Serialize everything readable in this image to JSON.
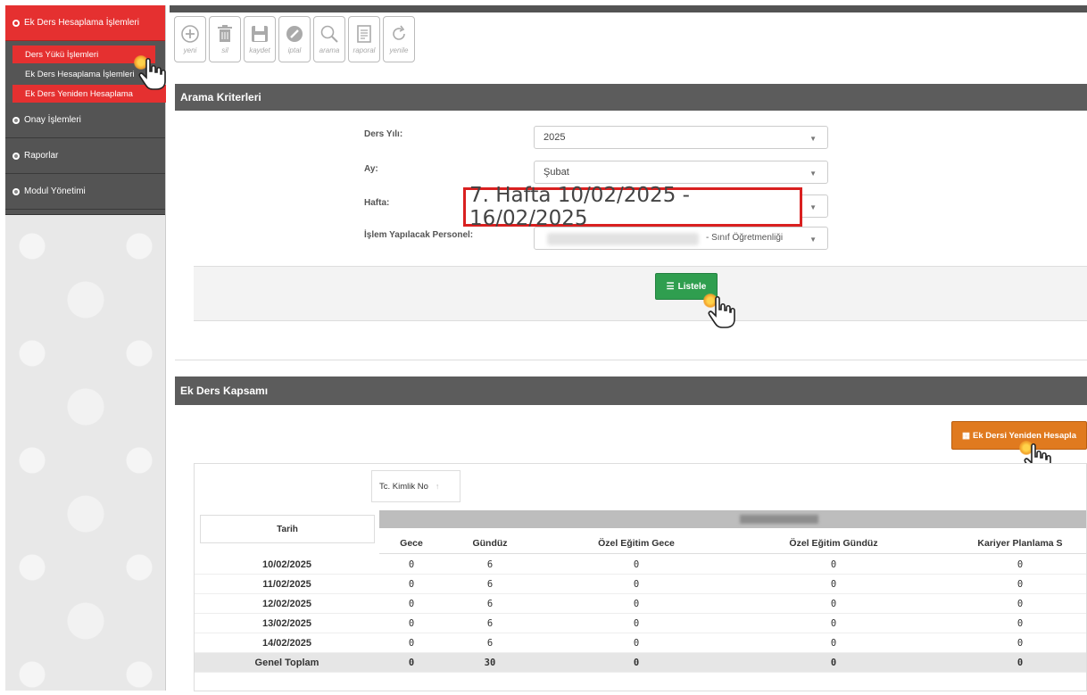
{
  "sidebar": {
    "sections": [
      {
        "label": "Ek Ders Hesaplama İşlemleri",
        "active": true
      },
      {
        "label": "Onay İşlemleri"
      },
      {
        "label": "Raporlar"
      },
      {
        "label": "Modul Yönetimi"
      }
    ],
    "sub_items": [
      {
        "label": "Ders Yükü İşlemleri"
      },
      {
        "label": "Ek Ders Hesaplama İşlemleri"
      },
      {
        "label": "Ek Ders Yeniden Hesaplama"
      }
    ]
  },
  "toolbar": {
    "buttons": [
      {
        "label": "yeni",
        "icon": "plus-circle-icon"
      },
      {
        "label": "sil",
        "icon": "trash-icon"
      },
      {
        "label": "kaydet",
        "icon": "save-icon"
      },
      {
        "label": "iptal",
        "icon": "cancel-icon"
      },
      {
        "label": "arama",
        "icon": "search-icon"
      },
      {
        "label": "raporal",
        "icon": "report-icon"
      },
      {
        "label": "yenile",
        "icon": "refresh-icon"
      }
    ]
  },
  "arama": {
    "title": "Arama Kriterleri",
    "ders_yili_label": "Ders Yılı:",
    "ders_yili_value": "2025",
    "ay_label": "Ay:",
    "ay_value": "Şubat",
    "hafta_label": "Hafta:",
    "hafta_value": "7. Hafta 10/02/2025 - 16/02/2025",
    "personel_label": "İşlem Yapılacak Personel:",
    "personel_value_suffix": "- Sınıf Öğretmenliği",
    "listele_label": "Listele"
  },
  "ek_ders": {
    "title": "Ek Ders Kapsamı",
    "yeniden_hesapla_label": "Ek Dersi Yeniden Hesapla",
    "tc_header": "Tc. Kimlik No",
    "tarih_header": "Tarih",
    "columns": [
      "Gece",
      "Gündüz",
      "Özel Eğitim Gece",
      "Özel Eğitim Gündüz",
      "Kariyer Planlama S"
    ],
    "rows": [
      {
        "date": "10/02/2025",
        "values": [
          "0",
          "6",
          "0",
          "0",
          "0"
        ]
      },
      {
        "date": "11/02/2025",
        "values": [
          "0",
          "6",
          "0",
          "0",
          "0"
        ]
      },
      {
        "date": "12/02/2025",
        "values": [
          "0",
          "6",
          "0",
          "0",
          "0"
        ]
      },
      {
        "date": "13/02/2025",
        "values": [
          "0",
          "6",
          "0",
          "0",
          "0"
        ]
      },
      {
        "date": "14/02/2025",
        "values": [
          "0",
          "6",
          "0",
          "0",
          "0"
        ]
      }
    ],
    "total": {
      "label": "Genel Toplam",
      "values": [
        "0",
        "30",
        "0",
        "0",
        "0"
      ]
    }
  },
  "colors": {
    "accent_red": "#e53030",
    "header_gray": "#5c5c5c",
    "listele_green": "#2f9e4f",
    "yeniden_orange": "#e07a1f"
  }
}
